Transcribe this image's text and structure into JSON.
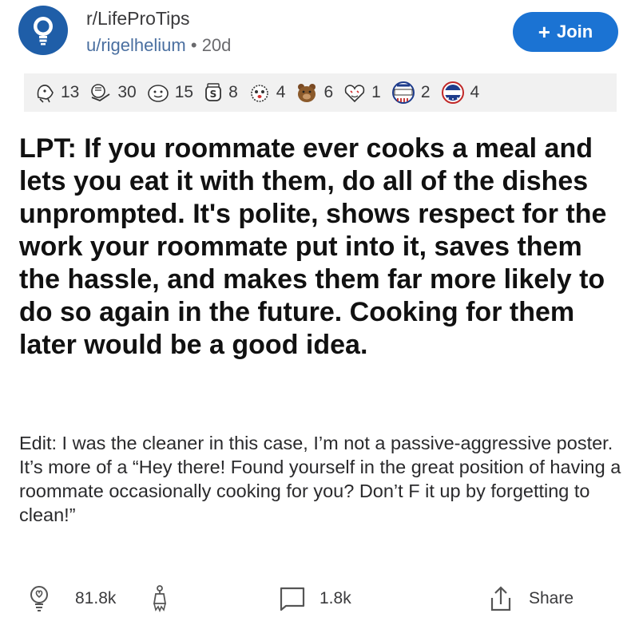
{
  "header": {
    "subreddit": "r/LifeProTips",
    "username": "u/rigelhelium",
    "separator": "•",
    "age": "20d",
    "join_label": "Join"
  },
  "awards": [
    {
      "icon": "wholesome-seal-icon",
      "count": "13"
    },
    {
      "icon": "hug-icon",
      "count": "30"
    },
    {
      "icon": "face-award-icon",
      "count": "15"
    },
    {
      "icon": "jar-award-icon",
      "count": "8"
    },
    {
      "icon": "shocked-face-icon",
      "count": "4"
    },
    {
      "icon": "bear-award-icon",
      "count": "6"
    },
    {
      "icon": "heart-eyes-icon",
      "count": "1"
    },
    {
      "icon": "voted-pin-icon",
      "count": "2"
    },
    {
      "icon": "vote-badge-icon",
      "count": "4"
    }
  ],
  "post": {
    "title": "LPT: If you roommate ever cooks a meal and lets you eat it with them, do all of the dishes unprompted. It's polite, shows respect for the work your roommate put into it, saves them the hassle, and makes them far more likely to do so again in the future. Cooking for them later would be a good idea.",
    "edit": "Edit: I was the cleaner in this case, I’m not a passive-aggressive poster. It’s more of a “Hey there! Found yourself in the great position of having a roommate occasionally cooking for you? Don’t F it up by forgetting to clean!”"
  },
  "actions": {
    "upvotes": "81.8k",
    "comments": "1.8k",
    "share_label": "Share"
  },
  "colors": {
    "accent": "#1b73d3",
    "avatar_bg": "#1f5ea8",
    "award_bar_bg": "#f1f1f1"
  }
}
